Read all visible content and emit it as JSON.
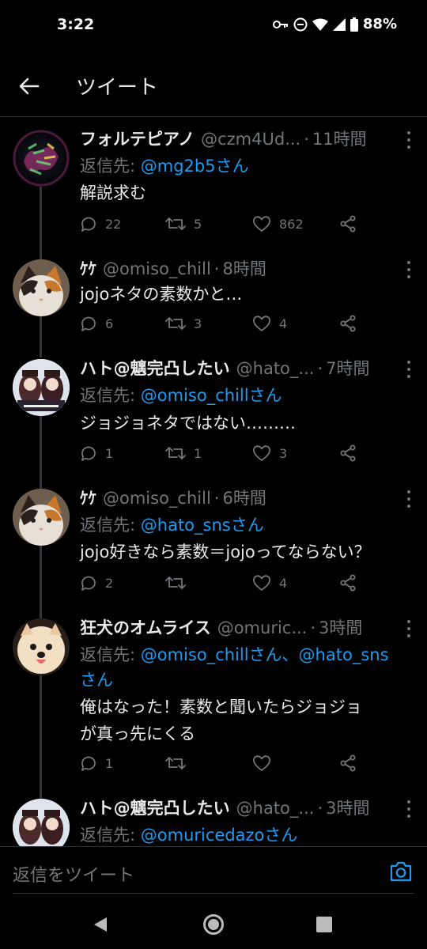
{
  "status_bar": {
    "time": "3:22",
    "battery": "88%"
  },
  "header": {
    "title": "ツイート"
  },
  "tweets": [
    {
      "name": "フォルテピアノ",
      "handle": "@czm4Ud...",
      "time": "11時間",
      "reply_prefix": "返信先: ",
      "reply_to": "@mg2b5さん",
      "text": "解説求む",
      "replies": "22",
      "retweets": "5",
      "likes": "862",
      "avatar": "touhou-logo"
    },
    {
      "name": "ｹｹ",
      "handle": "@omiso_chill",
      "time": "8時間",
      "reply_prefix": "",
      "reply_to": "",
      "text": "jojoネタの素数かと…",
      "replies": "6",
      "retweets": "3",
      "likes": "4",
      "avatar": "calico-cat"
    },
    {
      "name": "ハト@魑完凸したい",
      "handle": "@hato_...",
      "time": "7時間",
      "reply_prefix": "返信先: ",
      "reply_to": "@omiso_chillさん",
      "text": "ジョジョネタではない………",
      "replies": "1",
      "retweets": "1",
      "likes": "3",
      "avatar": "anime-characters"
    },
    {
      "name": "ｹｹ",
      "handle": "@omiso_chill",
      "time": "6時間",
      "reply_prefix": "返信先: ",
      "reply_to": "@hato_snsさん",
      "text": "jojo好きなら素数＝jojoってならない？",
      "replies": "2",
      "retweets": "",
      "likes": "4",
      "avatar": "calico-cat"
    },
    {
      "name": "狂犬のオムライス",
      "handle": "@omuric...",
      "time": "3時間",
      "reply_prefix": "返信先: ",
      "reply_to": "@omiso_chillさん、@hato_sns",
      "reply_to_line2": "さん",
      "text": "俺はなった！素数と聞いたらジョジョ",
      "text_line2": "が真っ先にくる",
      "replies": "1",
      "retweets": "",
      "likes": "",
      "avatar": "pomeranian-dog"
    },
    {
      "name": "ハト@魑完凸したい",
      "handle": "@hato_...",
      "time": "3時間",
      "reply_prefix": "返信先: ",
      "reply_to": "@omuricedazoさん",
      "avatar": "anime-characters"
    }
  ],
  "reply_bar": {
    "placeholder": "返信をツイート"
  },
  "colors": {
    "background": "#000000",
    "mention": "#1d9bf0",
    "secondary_text": "#71767b",
    "divider": "#2f3336"
  }
}
